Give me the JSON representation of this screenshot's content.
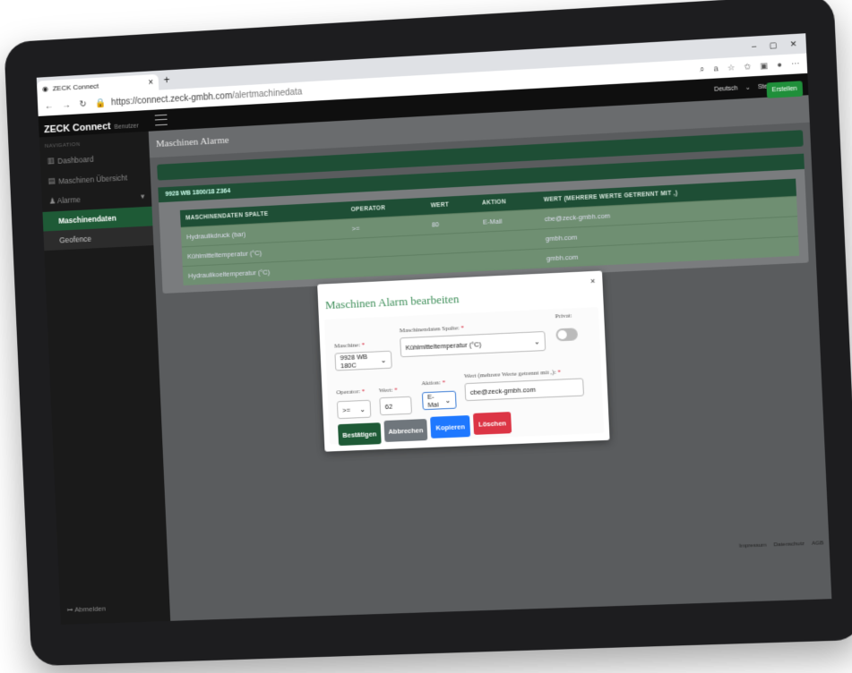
{
  "browser": {
    "tab_title": "ZECK Connect",
    "url_host": "https://connect.zeck-gmbh.com",
    "url_path": "/alertmachinedata"
  },
  "header": {
    "language": "Deutsch",
    "user": "Stefanie Gries",
    "create_label": "Erstellen"
  },
  "sidebar": {
    "brand": "ZECK Connect",
    "brand_sub": "Benutzer",
    "nav_header": "NAVIGATION",
    "items": [
      {
        "label": "Dashboard"
      },
      {
        "label": "Maschinen Übersicht"
      },
      {
        "label": "Alarme"
      },
      {
        "label": "Maschinendaten"
      },
      {
        "label": "Geofence"
      }
    ],
    "logout": "Abmelden"
  },
  "page": {
    "title": "Maschinen Alarme",
    "card_title": "9928 WB 1800/18 Z364",
    "columns": [
      "MASCHINENDATEN SPALTE",
      "OPERATOR",
      "WERT",
      "AKTION",
      "WERT (MEHRERE WERTE GETRENNT MIT ,)"
    ],
    "rows": [
      [
        "Hydraulikdruck (bar)",
        ">=",
        "80",
        "E-Mail",
        "cbe@zeck-gmbh.com"
      ],
      [
        "Kühlmitteltemperatur (°C)",
        "",
        "",
        "",
        "gmbh.com"
      ],
      [
        "Hydraulikoeltemperatur (°C)",
        "",
        "",
        "",
        "gmbh.com"
      ]
    ]
  },
  "footer": {
    "impressum": "Impressum",
    "datenschutz": "Datenschutz",
    "agb": "AGB"
  },
  "modal": {
    "title": "Maschinen Alarm bearbeiten",
    "close": "×",
    "machine_label": "Maschine:",
    "machine_value": "9928 WB 180C",
    "column_label": "Maschinendaten Spalte:",
    "column_value": "Kühlmitteltemperatur (°C)",
    "private_label": "Privat:",
    "operator_label": "Operator:",
    "operator_value": ">=",
    "wert_label": "Wert:",
    "wert_value": "62",
    "aktion_label": "Aktion:",
    "aktion_value": "E-Mai",
    "multi_label": "Wert (mehrere Werte getrennt mit ,):",
    "multi_value": "cbe@zeck-gmbh.com",
    "required_mark": "*",
    "buttons": {
      "confirm": "Bestätigen",
      "cancel": "Abbrechen",
      "copy": "Kopieren",
      "delete": "Löschen"
    }
  }
}
